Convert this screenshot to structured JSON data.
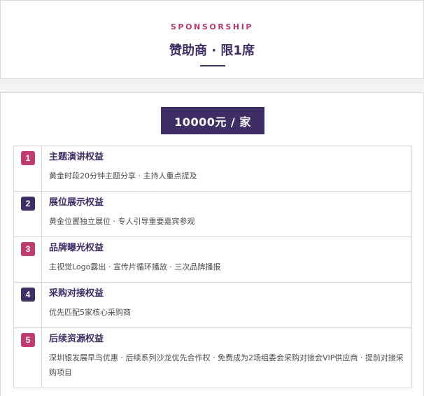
{
  "header": {
    "eyebrow": "SPONSORSHIP",
    "title": "赞助商 · 限1席"
  },
  "main": {
    "price": "10000元 / 家",
    "benefits": [
      {
        "number": "1",
        "title": "主题演讲权益",
        "description": "黄金时段20分钟主题分享 · 主持人重点提及",
        "badge_color": "#c03b70"
      },
      {
        "number": "2",
        "title": "展位展示权益",
        "description": "黄金位置独立展位 · 专人引导重要嘉宾参观",
        "badge_color": "#3f2d66"
      },
      {
        "number": "3",
        "title": "品牌曝光权益",
        "description": "主视觉Logo露出 · 宣传片循环播放 · 三次品牌播报",
        "badge_color": "#c03b70"
      },
      {
        "number": "4",
        "title": "采购对接权益",
        "description": "优先匹配5家核心采购商",
        "badge_color": "#3f2d66"
      },
      {
        "number": "5",
        "title": "后续资源权益",
        "description": "深圳银发展早鸟优惠 · 后续系列沙龙优先合作权 · 免费成为2场组委会采购对接会VIP供应商 · 提前对接采购项目",
        "badge_color": "#c03b70"
      }
    ]
  },
  "colors": {
    "accent_purple": "#3f2d66",
    "accent_magenta": "#c03b70",
    "background": "#f2f2f2",
    "card": "#ffffff",
    "border": "#d7d7d7"
  }
}
